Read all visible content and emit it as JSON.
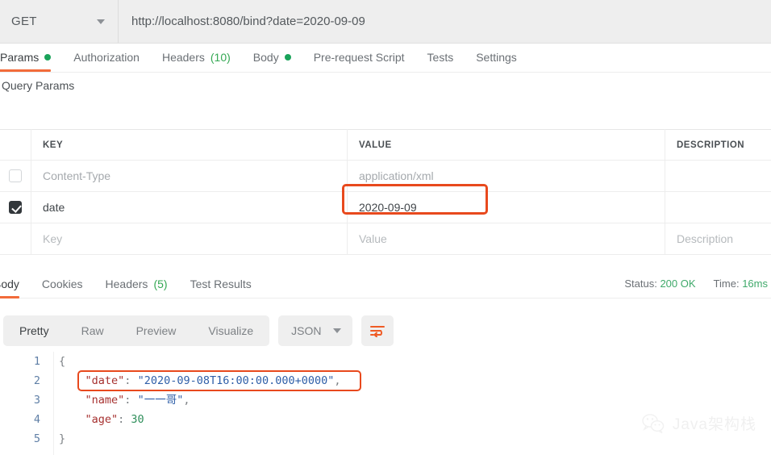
{
  "request": {
    "method": "GET",
    "method_icon": "chevron-down-icon",
    "url": "http://localhost:8080/bind?date=2020-09-09",
    "tabs": [
      {
        "label": "Params",
        "badge_dot": true,
        "active": true
      },
      {
        "label": "Authorization",
        "badge_dot": false,
        "active": false
      },
      {
        "label": "Headers",
        "count": "(10)",
        "badge_dot": false,
        "active": false
      },
      {
        "label": "Body",
        "badge_dot": true,
        "active": false
      },
      {
        "label": "Pre-request Script",
        "badge_dot": false,
        "active": false
      },
      {
        "label": "Tests",
        "badge_dot": false,
        "active": false
      },
      {
        "label": "Settings",
        "badge_dot": false,
        "active": false
      }
    ]
  },
  "params": {
    "section_title": "Query Params",
    "columns": {
      "key": "KEY",
      "value": "VALUE",
      "description": "DESCRIPTION"
    },
    "rows": [
      {
        "checked": false,
        "key": "Content-Type",
        "value": "application/xml",
        "description": "",
        "muted": true
      },
      {
        "checked": true,
        "key": "date",
        "value": "2020-09-09",
        "description": "",
        "muted": false,
        "highlighted": true
      },
      {
        "checked": false,
        "key": "Key",
        "value": "Value",
        "description": "Description",
        "placeholder": true
      }
    ]
  },
  "response": {
    "tabs": [
      {
        "label": "Body",
        "active": true
      },
      {
        "label": "Cookies",
        "active": false
      },
      {
        "label": "Headers",
        "count": "(5)",
        "active": false
      },
      {
        "label": "Test Results",
        "active": false
      }
    ],
    "status_label": "Status:",
    "status_value": "200 OK",
    "time_label": "Time:",
    "time_value": "16ms",
    "format_views": [
      {
        "label": "Pretty",
        "active": true
      },
      {
        "label": "Raw",
        "active": false
      },
      {
        "label": "Preview",
        "active": false
      },
      {
        "label": "Visualize",
        "active": false
      }
    ],
    "language_select": "JSON",
    "language_caret_icon": "chevron-down-icon",
    "wrap_icon": "word-wrap-icon",
    "line_numbers": [
      "1",
      "2",
      "3",
      "4",
      "5"
    ],
    "body_lines": [
      {
        "punct_open": "{"
      },
      {
        "key": "\"date\"",
        "colon": ": ",
        "string": "\"2020-09-08T16:00:00.000+0000\"",
        "comma": ","
      },
      {
        "key": "\"name\"",
        "colon": ": ",
        "string": "\"一一哥\"",
        "comma": ","
      },
      {
        "key": "\"age\"",
        "colon": ": ",
        "number": "30"
      },
      {
        "punct_close": "}"
      }
    ]
  },
  "watermark": {
    "icon": "wechat-icon",
    "text": "Java架构栈"
  },
  "colors": {
    "accent_orange": "#f26b3a",
    "annotation_red": "#e8491d",
    "status_green": "#3fa96a",
    "dot_green": "#1aa35a",
    "json_key": "#a6302f",
    "json_string": "#2f5fa8",
    "json_number": "#2f8f5b"
  }
}
